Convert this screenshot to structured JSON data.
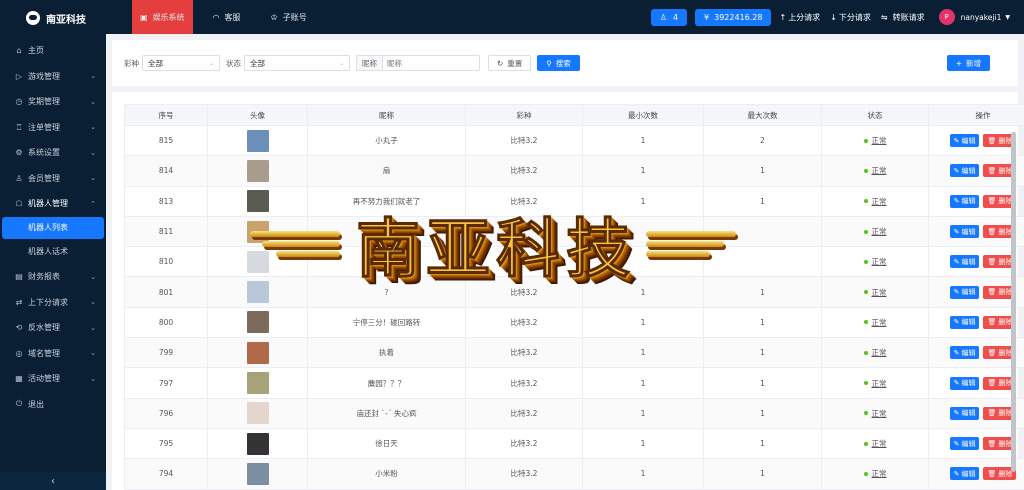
{
  "app": {
    "name": "南亚科技"
  },
  "sidebar": {
    "items": [
      {
        "label": "主页",
        "icon": "home-icon"
      },
      {
        "label": "游戏管理",
        "icon": "play-icon"
      },
      {
        "label": "奖期管理",
        "icon": "clock-icon"
      },
      {
        "label": "注单管理",
        "icon": "trophy-icon"
      },
      {
        "label": "系统设置",
        "icon": "settings-icon"
      },
      {
        "label": "会员管理",
        "icon": "user-icon"
      },
      {
        "label": "机器人管理",
        "icon": "robot-icon"
      }
    ],
    "subitems": [
      {
        "label": "机器人列表",
        "active": true
      },
      {
        "label": "机器人话术",
        "active": false
      }
    ],
    "items2": [
      {
        "label": "财务报表",
        "icon": "report-icon"
      },
      {
        "label": "上下分请求",
        "icon": "transfer-icon"
      },
      {
        "label": "反水管理",
        "icon": "rebate-icon"
      },
      {
        "label": "域名管理",
        "icon": "domain-icon"
      },
      {
        "label": "活动管理",
        "icon": "calendar-icon"
      },
      {
        "label": "退出",
        "icon": "logout-icon"
      }
    ],
    "collapse_label": "‹"
  },
  "topbar": {
    "tabs": [
      {
        "label": "娱乐系统",
        "icon": "gift-icon",
        "active": true
      },
      {
        "label": "客服",
        "icon": "headset-icon",
        "active": false
      },
      {
        "label": "子账号",
        "icon": "crown-icon",
        "active": false
      }
    ],
    "online_count": "4",
    "balance": "3922416.28",
    "up_request": "上分请求",
    "down_request": "下分请求",
    "transfer_request": "转账请求",
    "avatar_letter": "P",
    "username": "nanyakeji1"
  },
  "filter": {
    "lottery_label": "彩种",
    "lottery_value": "全部",
    "status_label": "状态",
    "status_value": "全部",
    "nickname_label": "昵称",
    "nickname_placeholder": "昵称",
    "reset_label": "重置",
    "search_label": "搜索",
    "add_label": "新增"
  },
  "table": {
    "columns": [
      "序号",
      "头像",
      "昵称",
      "彩种",
      "最小次数",
      "最大次数",
      "状态",
      "操作"
    ],
    "edit_label": "编辑",
    "delete_label": "删除",
    "rows": [
      {
        "id": "815",
        "nickname": "小丸子",
        "lottery": "比特3.2",
        "min": "1",
        "max": "2",
        "status": "正常",
        "avatar_color": "#6b8fb8"
      },
      {
        "id": "814",
        "nickname": "扇",
        "lottery": "比特3.2",
        "min": "1",
        "max": "1",
        "status": "正常",
        "avatar_color": "#a89d8c"
      },
      {
        "id": "813",
        "nickname": "再不努力我们就老了",
        "lottery": "比特3.2",
        "min": "1",
        "max": "1",
        "status": "正常",
        "avatar_color": "#5a5b52"
      },
      {
        "id": "811",
        "nickname": "",
        "lottery": "",
        "min": "",
        "max": "",
        "status": "正常",
        "avatar_color": "#c9a26d"
      },
      {
        "id": "810",
        "nickname": "",
        "lottery": "",
        "min": "",
        "max": "",
        "status": "正常",
        "avatar_color": "#d7dbe0"
      },
      {
        "id": "801",
        "nickname": "?",
        "lottery": "比特3.2",
        "min": "1",
        "max": "1",
        "status": "正常",
        "avatar_color": "#b8c8d8"
      },
      {
        "id": "800",
        "nickname": "宁停三分！碰回路转",
        "lottery": "比特3.2",
        "min": "1",
        "max": "1",
        "status": "正常",
        "avatar_color": "#7c6a5a"
      },
      {
        "id": "799",
        "nickname": "执着",
        "lottery": "比特3.2",
        "min": "1",
        "max": "1",
        "status": "正常",
        "avatar_color": "#b06a4a"
      },
      {
        "id": "797",
        "nickname": "麋园？？？",
        "lottery": "比特3.2",
        "min": "1",
        "max": "1",
        "status": "正常",
        "avatar_color": "#a8a27a"
      },
      {
        "id": "796",
        "nickname": "庙还封 `-´ 失心疯",
        "lottery": "比特3.2",
        "min": "1",
        "max": "1",
        "status": "正常",
        "avatar_color": "#e4d6cc"
      },
      {
        "id": "795",
        "nickname": "徐日天",
        "lottery": "比特3.2",
        "min": "1",
        "max": "1",
        "status": "正常",
        "avatar_color": "#333335"
      },
      {
        "id": "794",
        "nickname": "小米粉",
        "lottery": "比特3.2",
        "min": "1",
        "max": "1",
        "status": "正常",
        "avatar_color": "#7c8fa0"
      }
    ]
  },
  "watermark": {
    "text": "南亚科技"
  }
}
